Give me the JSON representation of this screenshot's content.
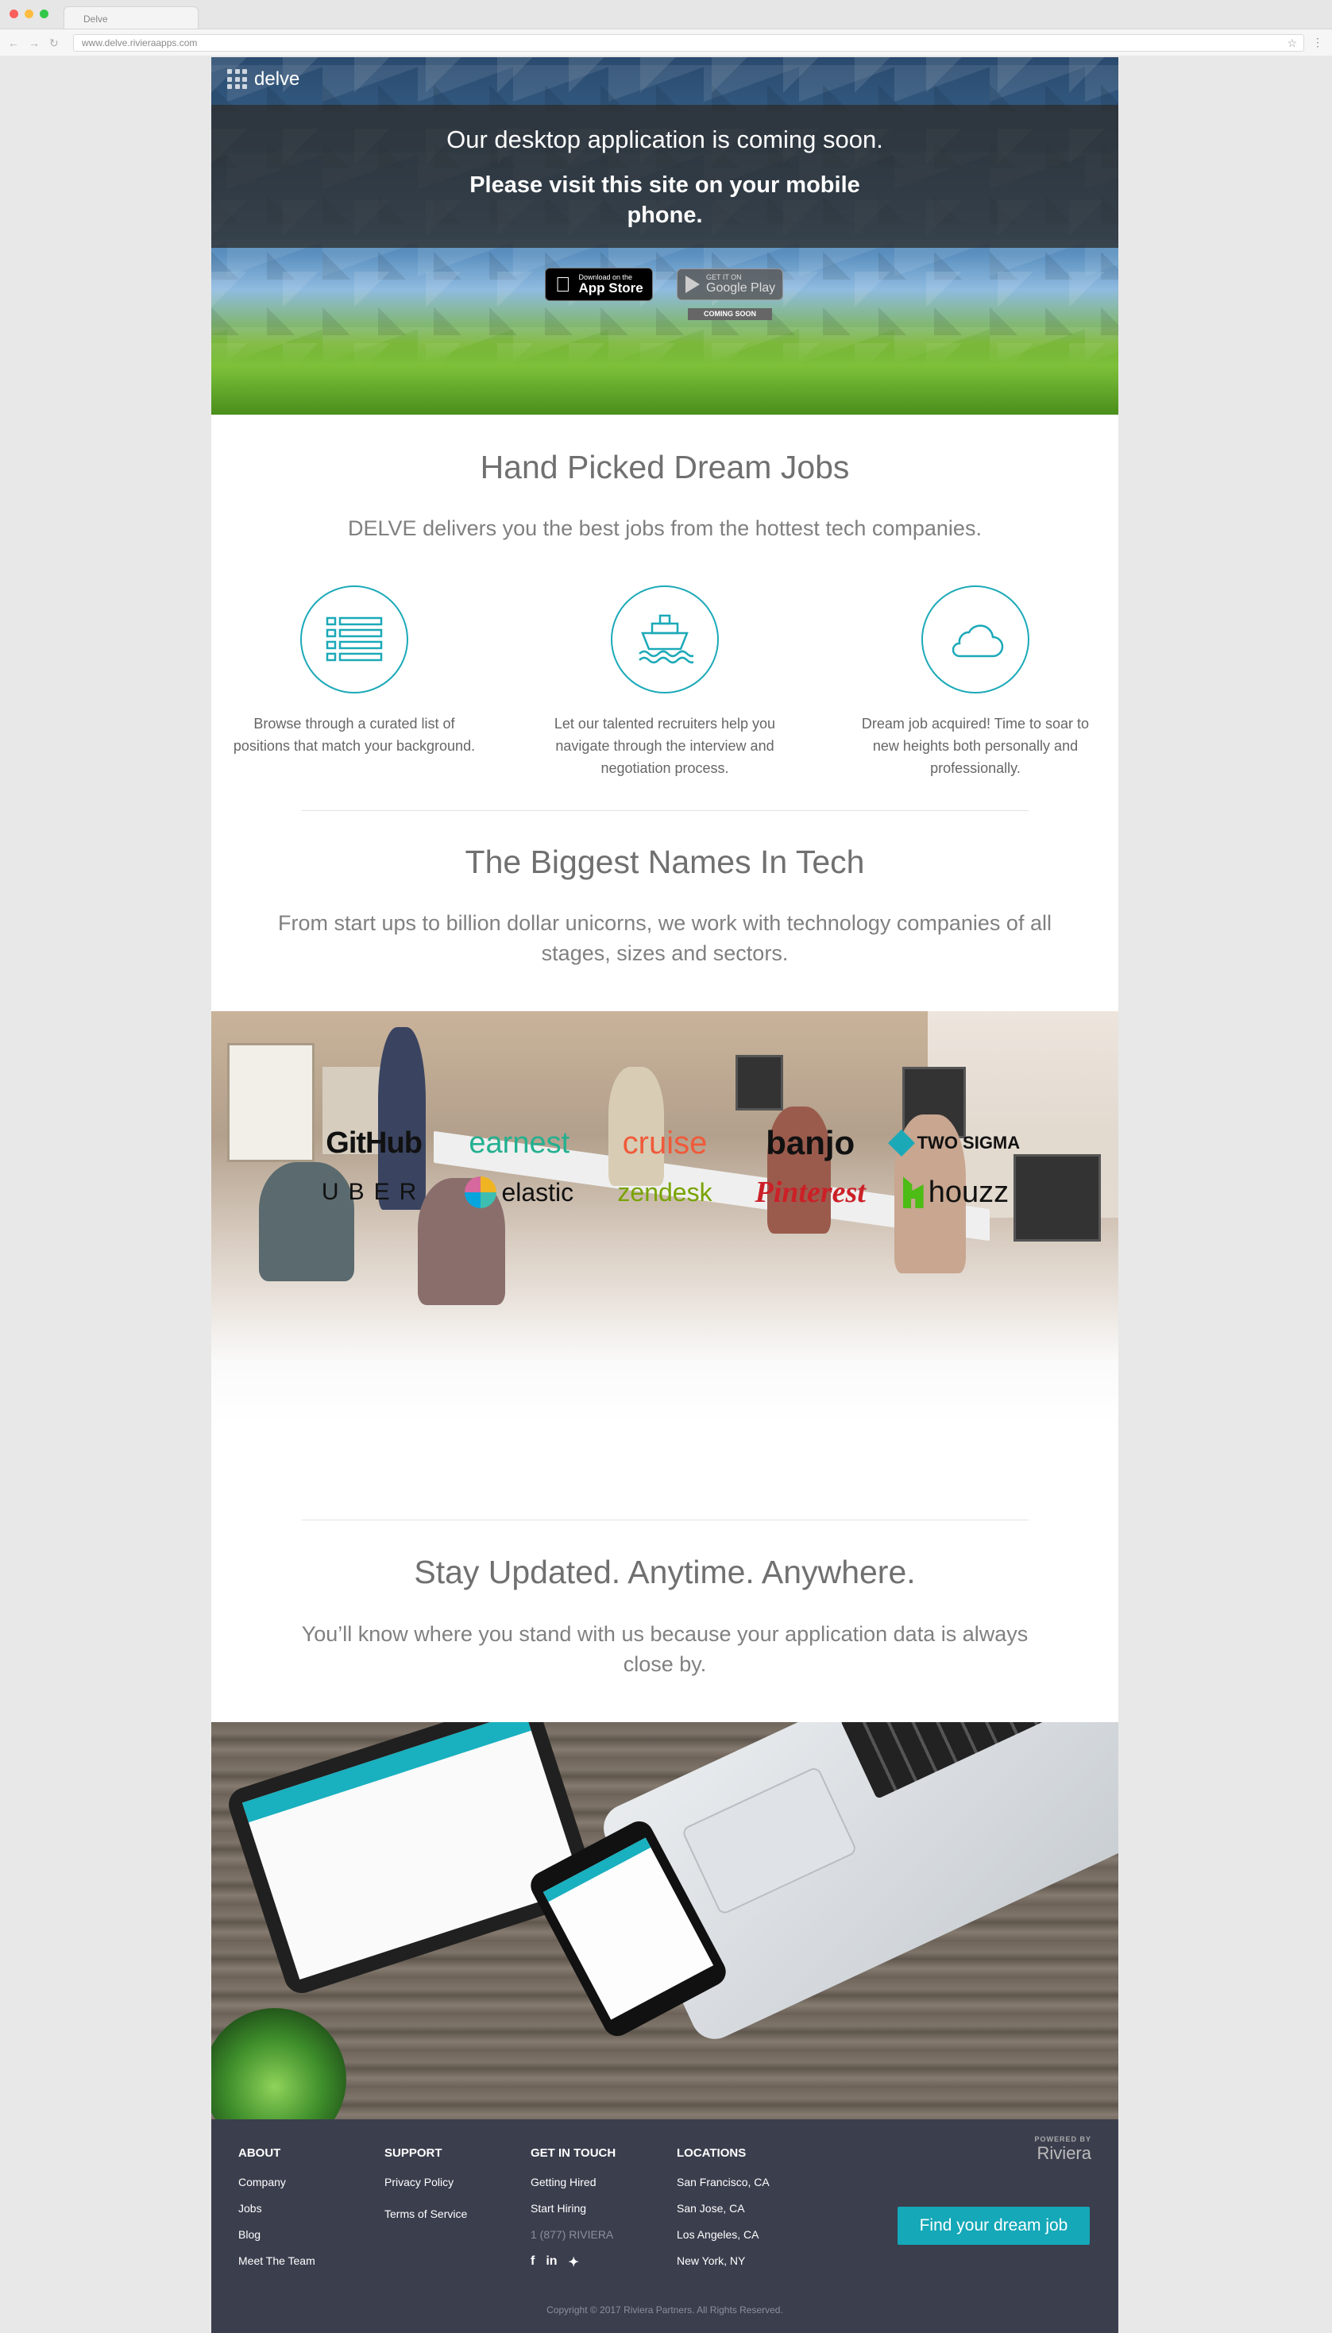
{
  "browser": {
    "tab_title": "Delve",
    "url": "www.delve.rivieraapps.com"
  },
  "hero": {
    "logo": "delve",
    "coming_soon": "Our desktop application is coming soon.",
    "visit_mobile": "Please visit this site on your mobile phone.",
    "appstore_small": "Download on the",
    "appstore_big": "App Store",
    "googleplay_small": "GET IT ON",
    "googleplay_big": "Google Play",
    "coming_soon_badge": "COMING SOON"
  },
  "dream_jobs": {
    "title": "Hand Picked Dream Jobs",
    "subtitle": "DELVE delivers you the best jobs from the hottest tech companies.",
    "features": [
      {
        "icon": "list-icon",
        "text": "Browse through a curated list of positions that match your background."
      },
      {
        "icon": "ship-icon",
        "text": "Let our talented recruiters help you navigate through the interview and negotiation process."
      },
      {
        "icon": "cloud-icon",
        "text": "Dream job acquired! Time to soar to new heights both personally and professionally."
      }
    ]
  },
  "tech": {
    "title": "The Biggest Names In Tech",
    "subtitle": "From start ups to billion dollar unicorns, we work with technology companies of all stages, sizes and sectors.",
    "logos": [
      "GitHub",
      "earnest",
      "cruise",
      "banjo",
      "TWO SIGMA",
      "UBER",
      "elastic",
      "zendesk",
      "Pinterest",
      "houzz"
    ]
  },
  "updated": {
    "title": "Stay Updated. Anytime. Anywhere.",
    "subtitle": "You’ll know where you stand with us because your application data is always close by."
  },
  "footer": {
    "about": {
      "title": "ABOUT",
      "links": [
        "Company",
        "Jobs",
        "Blog",
        "Meet The Team"
      ]
    },
    "support": {
      "title": "SUPPORT",
      "links": [
        "Privacy Policy",
        "Terms of Service"
      ]
    },
    "contact": {
      "title": "GET IN TOUCH",
      "links": [
        "Getting Hired",
        "Start Hiring"
      ],
      "phone": "1 (877) RIVIERA"
    },
    "locations": {
      "title": "LOCATIONS",
      "links": [
        "San Francisco, CA",
        "San Jose, CA",
        "Los Angeles, CA",
        "New York, NY"
      ]
    },
    "powered_by": "POWERED BY",
    "powered_brand": "Riviera",
    "cta": "Find your dream job",
    "copyright": "Copyright © 2017 Riviera Partners. All Rights Reserved.",
    "social": [
      "facebook-icon",
      "linkedin-icon",
      "twitter-icon"
    ]
  },
  "colors": {
    "accent": "#14a8b8",
    "footer_bg": "#3b3e4d"
  }
}
